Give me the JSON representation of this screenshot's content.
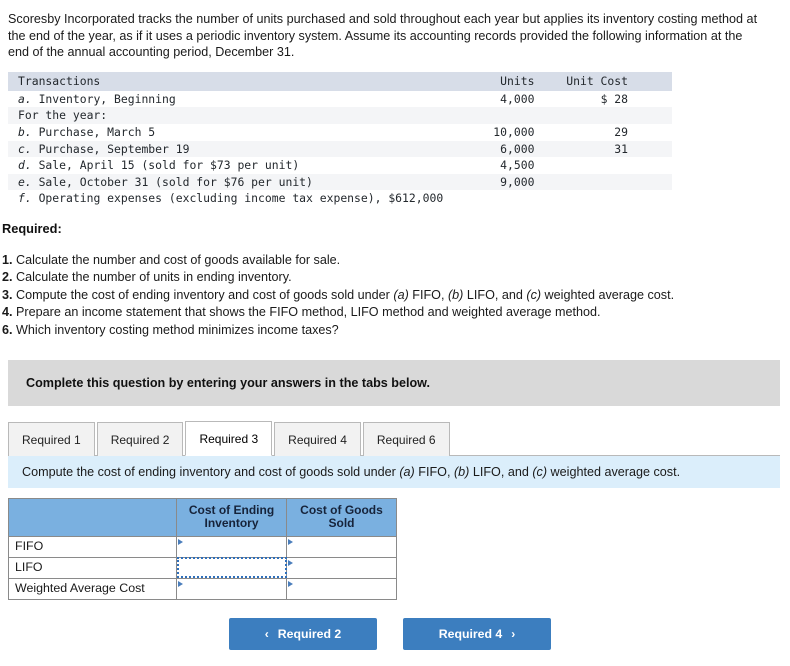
{
  "intro": {
    "paragraph": "Scoresby Incorporated tracks the number of units purchased and sold throughout each year but applies its inventory costing method at the end of the year, as if it uses a periodic inventory system. Assume its accounting records provided the following information at the end of the annual accounting period, December 31."
  },
  "transactions_table": {
    "headers": {
      "transactions": "Transactions",
      "units": "Units",
      "unit_cost": "Unit Cost"
    },
    "rows": [
      {
        "marker": "a.",
        "label": " Inventory, Beginning",
        "units": "4,000",
        "unit_cost": "$ 28",
        "shaded": false
      },
      {
        "marker": "",
        "label": "For the year:",
        "units": "",
        "unit_cost": "",
        "shaded": true
      },
      {
        "marker": "b.",
        "label": " Purchase, March 5",
        "units": "10,000",
        "unit_cost": "29",
        "shaded": false
      },
      {
        "marker": "c.",
        "label": " Purchase, September 19",
        "units": "6,000",
        "unit_cost": "31",
        "shaded": true
      },
      {
        "marker": "d.",
        "label": " Sale, April 15 (sold for $73 per unit)",
        "units": "4,500",
        "unit_cost": "",
        "shaded": false
      },
      {
        "marker": "e.",
        "label": " Sale, October 31 (sold for $76 per unit)",
        "units": "9,000",
        "unit_cost": "",
        "shaded": true
      },
      {
        "marker": "f.",
        "label": " Operating expenses (excluding income tax expense), $612,000",
        "units": "",
        "unit_cost": "",
        "shaded": false
      }
    ]
  },
  "required": {
    "heading": "Required:",
    "items": [
      {
        "number": "1.",
        "text": " Calculate the number and cost of goods available for sale."
      },
      {
        "number": "2.",
        "text": " Calculate the number of units in ending inventory."
      },
      {
        "number": "3.",
        "prefix": " Compute the cost of ending inventory and cost of goods sold under ",
        "a": "(a)",
        "mid1": " FIFO, ",
        "b": "(b)",
        "mid2": " LIFO, and ",
        "c": "(c)",
        "suffix": " weighted average cost."
      },
      {
        "number": "4.",
        "text": " Prepare an income statement that shows the FIFO method, LIFO method and weighted average method."
      },
      {
        "number": "6.",
        "text": " Which inventory costing method minimizes income taxes?"
      }
    ]
  },
  "gray_banner": {
    "text": "Complete this question by entering your answers in the tabs below."
  },
  "tabs": [
    {
      "label": "Required 1",
      "active": false
    },
    {
      "label": "Required 2",
      "active": false
    },
    {
      "label": "Required 3",
      "active": true
    },
    {
      "label": "Required 4",
      "active": false
    },
    {
      "label": "Required 6",
      "active": false
    }
  ],
  "blue_bar": {
    "prefix": "Compute the cost of ending inventory and cost of goods sold under ",
    "a": "(a)",
    "mid1": " FIFO, ",
    "b": "(b)",
    "mid2": " LIFO, and ",
    "c": "(c)",
    "suffix": " weighted average cost."
  },
  "answer_table": {
    "headers": {
      "corner": "",
      "ending_inventory": "Cost of Ending Inventory",
      "goods_sold": "Cost of Goods Sold"
    },
    "rows": [
      {
        "label": "FIFO",
        "ending_inventory": "",
        "goods_sold": ""
      },
      {
        "label": "LIFO",
        "ending_inventory": "",
        "goods_sold": ""
      },
      {
        "label": "Weighted Average Cost",
        "ending_inventory": "",
        "goods_sold": ""
      }
    ],
    "selected_cell": "LIFO / Cost of Ending Inventory"
  },
  "nav": {
    "prev_label": "Required 2",
    "next_label": "Required 4",
    "prev_chevron": "‹",
    "next_chevron": "›"
  },
  "colors": {
    "accent_blue": "#3c7ebf",
    "header_blue": "#7ab0e0",
    "info_bar": "#dbeefb",
    "gray_banner": "#d9d9d9",
    "txn_header": "#d7dde8"
  }
}
